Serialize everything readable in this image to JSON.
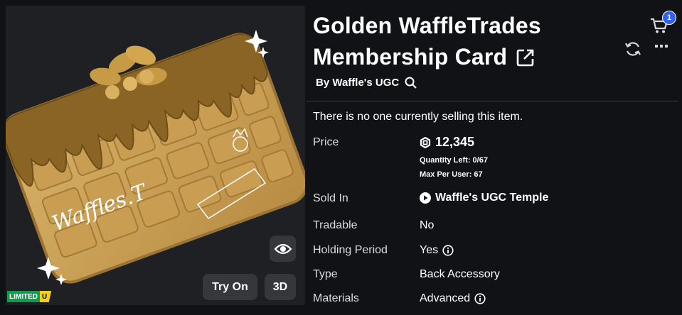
{
  "item": {
    "title_line1": "Golden WaffleTrades",
    "title_line2": "Membership Card",
    "by_prefix": "By ",
    "creator": "Waffle's UGC",
    "notice": "There is no one currently selling this item."
  },
  "thumbnail": {
    "card_text": "Waffles.T",
    "try_on_label": "Try On",
    "three_d_label": "3D",
    "limited_label": "LIMITED",
    "limited_u": "U"
  },
  "details": {
    "price_label": "Price",
    "price_value": "12,345",
    "quantity_left": "Quantity Left: 0/67",
    "max_per_user": "Max Per User: 67",
    "sold_in_label": "Sold In",
    "sold_in_value": "Waffle's UGC Temple",
    "tradable_label": "Tradable",
    "tradable_value": "No",
    "holding_label": "Holding Period",
    "holding_value": "Yes",
    "type_label": "Type",
    "type_value": "Back Accessory",
    "materials_label": "Materials",
    "materials_value": "Advanced"
  },
  "header": {
    "cart_count": "1"
  },
  "colors": {
    "background": "#111216",
    "panel": "#1f2024",
    "button": "#36373c",
    "badge": "#3360e6",
    "limited_green": "#0f9d4d",
    "limited_yellow": "#f3cf1c",
    "waffle_gold": "#c9a255"
  },
  "icons": [
    "external-link-icon",
    "search-icon",
    "robux-icon",
    "play-circle-icon",
    "info-icon",
    "eye-icon",
    "cart-icon",
    "refresh-icon",
    "more-icon",
    "sparkle-icon"
  ]
}
